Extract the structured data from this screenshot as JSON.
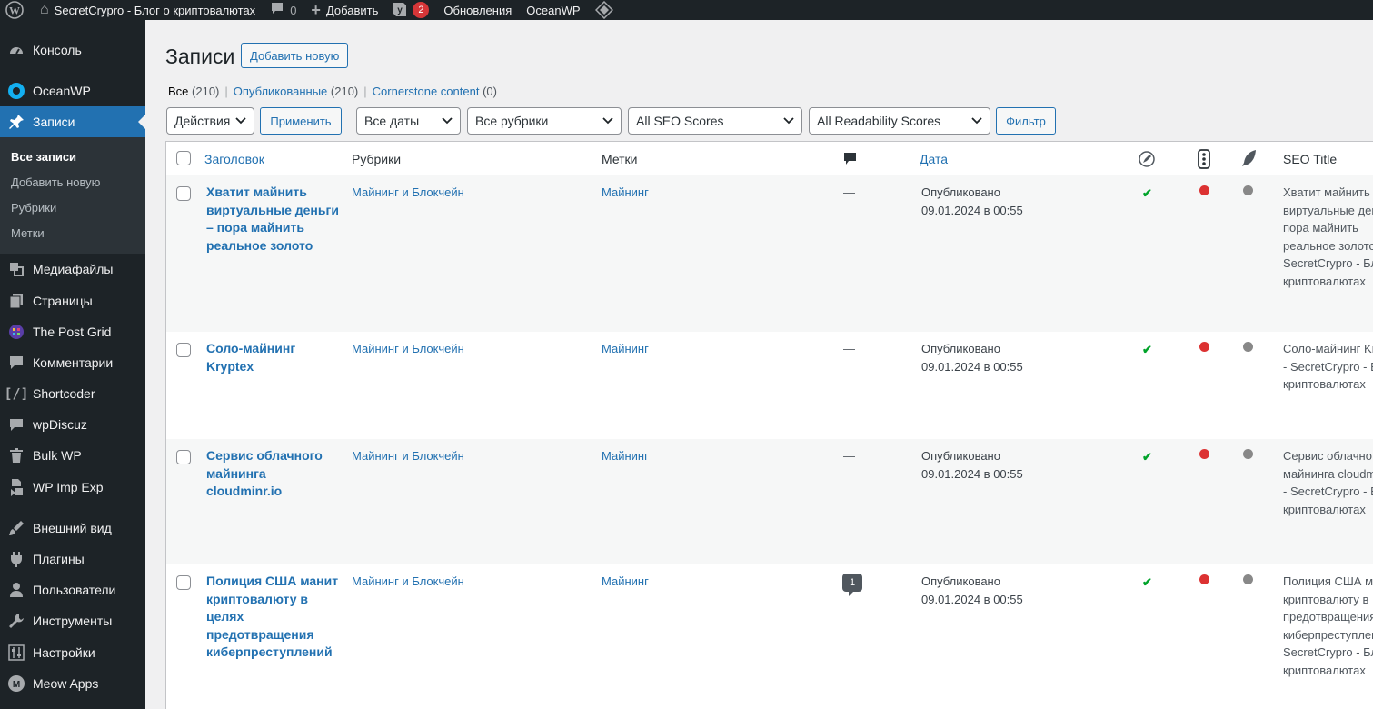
{
  "adminbar": {
    "site_name": "SecretCrypro - Блог о криптовалютах",
    "comments_count": "0",
    "add_new": "Добавить",
    "yoast_badge": "2",
    "updates": "Обновления",
    "theme": "OceanWP"
  },
  "sidebar": {
    "items": [
      {
        "label": "Консоль",
        "icon": "dashboard-icon"
      },
      {
        "label": "OceanWP",
        "icon": "oceanwp-icon"
      },
      {
        "label": "Записи",
        "icon": "pin-icon"
      },
      {
        "label": "Медиафайлы",
        "icon": "media-icon"
      },
      {
        "label": "Страницы",
        "icon": "pages-icon"
      },
      {
        "label": "The Post Grid",
        "icon": "post-grid-icon"
      },
      {
        "label": "Комментарии",
        "icon": "comments-icon"
      },
      {
        "label": "Shortcoder",
        "icon": "shortcode-icon"
      },
      {
        "label": "wpDiscuz",
        "icon": "discuz-icon"
      },
      {
        "label": "Bulk WP",
        "icon": "trash-icon"
      },
      {
        "label": "WP Imp Exp",
        "icon": "import-export-icon"
      },
      {
        "label": "Внешний вид",
        "icon": "appearance-icon"
      },
      {
        "label": "Плагины",
        "icon": "plugins-icon"
      },
      {
        "label": "Пользователи",
        "icon": "users-icon"
      },
      {
        "label": "Инструменты",
        "icon": "tools-icon"
      },
      {
        "label": "Настройки",
        "icon": "settings-icon"
      },
      {
        "label": "Meow Apps",
        "icon": "meow-icon"
      }
    ],
    "submenu": [
      "Все записи",
      "Добавить новую",
      "Рубрики",
      "Метки"
    ]
  },
  "page": {
    "title": "Записи",
    "add_new": "Добавить новую"
  },
  "views": {
    "all": "Все",
    "all_count": "(210)",
    "published": "Опубликованные",
    "published_count": "(210)",
    "cornerstone": "Cornerstone content",
    "cornerstone_count": "(0)"
  },
  "filters": {
    "bulk_action": "Действия",
    "apply": "Применить",
    "dates": "Все даты",
    "categories": "Все рубрики",
    "seo": "All SEO Scores",
    "readability": "All Readability Scores",
    "filter": "Фильтр"
  },
  "columns": {
    "title": "Заголовок",
    "categories": "Рубрики",
    "tags": "Метки",
    "date": "Дата",
    "seo_title": "SEO Title"
  },
  "rows": [
    {
      "title_lines": [
        "Хватит майнить",
        "виртуальные деньги",
        "– пора майнить",
        "реальное золото"
      ],
      "category": "Майнинг и Блокчейн",
      "tag": "Майнинг",
      "comments": "—",
      "status": "Опубликовано",
      "date": "09.01.2024 в 00:55",
      "seo_lines": [
        "Хватит майнить",
        "виртуальные ден",
        "пора майнить",
        "реальное золото",
        "SecretCrypro - Бл",
        "криптовалютах"
      ]
    },
    {
      "title_lines": [
        "Соло-майнинг",
        "Kryptex"
      ],
      "category": "Майнинг и Блокчейн",
      "tag": "Майнинг",
      "comments": "—",
      "status": "Опубликовано",
      "date": "09.01.2024 в 00:55",
      "seo_lines": [
        "Соло-майнинг Kr",
        "- SecretCrypro - Б",
        "криптовалютах"
      ]
    },
    {
      "title_lines": [
        "Сервис облачного",
        "майнинга",
        "cloudminr.io"
      ],
      "category": "Майнинг и Блокчейн",
      "tag": "Майнинг",
      "comments": "—",
      "status": "Опубликовано",
      "date": "09.01.2024 в 00:55",
      "seo_lines": [
        "Сервис облачно",
        "майнинга cloudm",
        "- SecretCrypro - Б",
        "криптовалютах"
      ]
    },
    {
      "title_lines": [
        "Полиция США манит",
        "криптовалюту в",
        "целях",
        "предотвращения",
        "киберпреступлений"
      ],
      "category": "Майнинг и Блокчейн",
      "tag": "Майнинг",
      "comments": "1",
      "status": "Опубликовано",
      "date": "09.01.2024 в 00:55",
      "seo_lines": [
        "Полиция США ма",
        "криптовалюту в",
        "предотвращения",
        "киберпреступлен",
        "SecretCrypro - Бл",
        "криптовалютах"
      ]
    }
  ]
}
